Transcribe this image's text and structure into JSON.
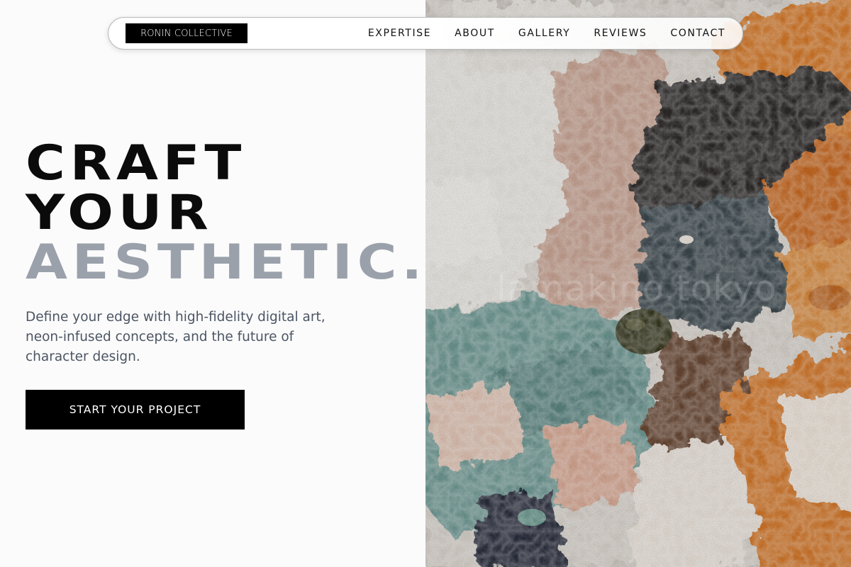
{
  "brand": {
    "logo_text": "RONIN COLLECTIVE"
  },
  "nav": {
    "links": [
      "EXPERTISE",
      "ABOUT",
      "GALLERY",
      "REVIEWS",
      "CONTACT"
    ]
  },
  "hero": {
    "headline": [
      "CRAFT",
      "YOUR",
      "AESTHETIC."
    ],
    "subtitle": "Define your edge with high-fidelity digital art, neon-infused concepts, and the future of character design.",
    "cta_label": "START YOUR PROJECT"
  },
  "artwork": {
    "watermark_text": "lamakino.tokyo",
    "palette": [
      "#e2ddd6",
      "#c89a86",
      "#d6772a",
      "#5f8c88",
      "#2b2627",
      "#3a3b2a"
    ]
  },
  "colors": {
    "headline_dark": "#0b0b0b",
    "headline_muted": "#9aa1ab",
    "body_text": "#4b5563",
    "button_bg": "#000000"
  }
}
